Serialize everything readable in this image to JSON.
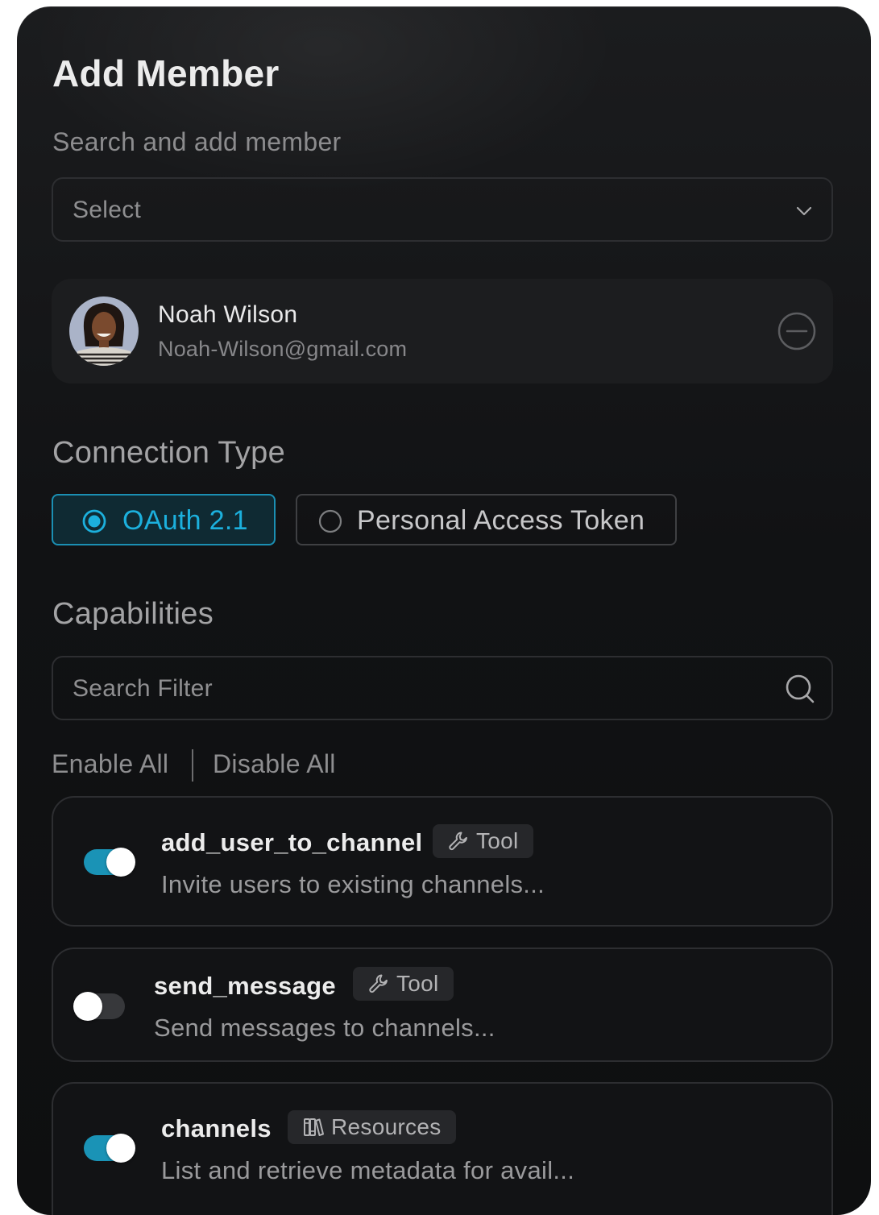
{
  "dialog": {
    "title": "Add Member",
    "search_label": "Search and add member",
    "select": {
      "value": "Select",
      "icon": "chevron-down-icon"
    }
  },
  "member": {
    "name": "Noah Wilson",
    "email": "Noah-Wilson@gmail.com",
    "avatar_icon": "avatar",
    "remove_icon": "minus-circle-icon"
  },
  "connection": {
    "title": "Connection Type",
    "options": [
      {
        "label": "OAuth 2.1",
        "selected": true
      },
      {
        "label": "Personal Access Token",
        "selected": false
      }
    ],
    "accent_color": "#1cb0dd"
  },
  "capabilities": {
    "title": "Capabilities",
    "search_placeholder": "Search Filter",
    "search_icon": "search-icon",
    "enable_all": "Enable All",
    "disable_all": "Disable All",
    "items": [
      {
        "name": "add_user_to_channel",
        "badge": "Tool",
        "badge_icon": "wrench-icon",
        "description": "Invite users to existing channels...",
        "enabled": true
      },
      {
        "name": "send_message",
        "badge": "Tool",
        "badge_icon": "wrench-icon",
        "description": "Send messages to channels...",
        "enabled": false
      },
      {
        "name": "channels",
        "badge": "Resources",
        "badge_icon": "books-icon",
        "description": "List and retrieve metadata for avail...",
        "enabled": true
      }
    ]
  }
}
